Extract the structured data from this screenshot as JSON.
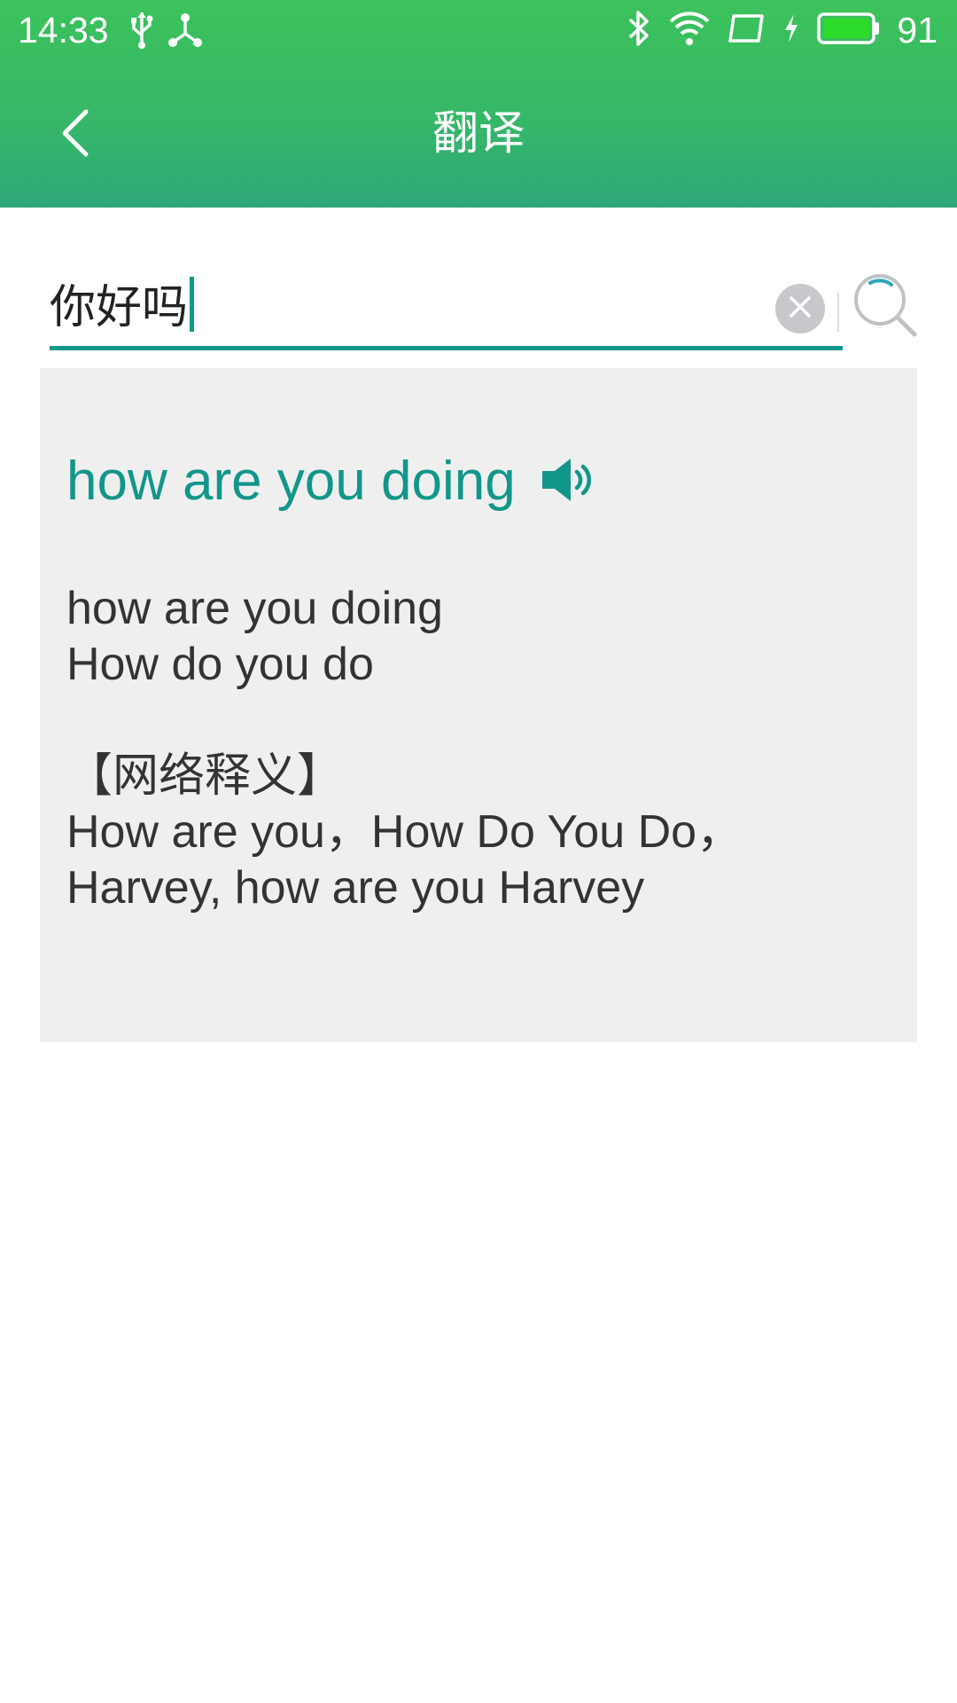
{
  "status_bar": {
    "time": "14:33",
    "battery_level": "91",
    "icons": [
      "usb-icon",
      "usb-tether-icon",
      "bluetooth-icon",
      "wifi-icon",
      "screen-rotation-icon",
      "charging-icon",
      "battery-icon"
    ]
  },
  "header": {
    "title": "翻译",
    "back_icon": "chevron-left-icon"
  },
  "search": {
    "value": "你好吗",
    "clear_icon": "close-icon",
    "search_icon": "search-icon"
  },
  "result": {
    "main_translation": "how are you doing",
    "speaker_icon": "speaker-icon",
    "lines": {
      "line1": "how are you doing",
      "line2": "How do you do",
      "web_heading": "【网络释义】",
      "web_line1": "How are you，How Do You Do，",
      "web_line2": "Harvey, how are you Harvey"
    }
  },
  "colors": {
    "header_green": "#3cc25c",
    "accent_teal": "#12968a",
    "panel_bg": "#efefef"
  }
}
